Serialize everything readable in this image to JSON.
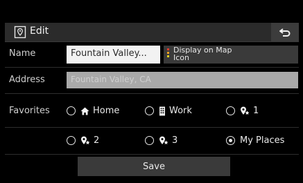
{
  "header": {
    "title": "Edit",
    "back_icon": "back-arrow-icon",
    "title_icon": "edit-location-icon"
  },
  "form": {
    "name": {
      "label": "Name",
      "value": "Fountain Valley..."
    },
    "display_on_map": {
      "line1": "Display on Map",
      "line2": "Icon",
      "swatch_colors": [
        "#e03c2e",
        "#f0a020",
        "#e8d020"
      ]
    },
    "address": {
      "label": "Address",
      "value": "Fountain Valley, CA"
    },
    "favorites": {
      "label": "Favorites",
      "options": [
        {
          "label": "Home",
          "icon": "home-icon",
          "checked": false
        },
        {
          "label": "Work",
          "icon": "work-building-icon",
          "checked": false
        },
        {
          "label": "1",
          "icon": "favorite-pin-icon",
          "checked": false
        },
        {
          "label": "2",
          "icon": "favorite-pin-icon",
          "checked": false
        },
        {
          "label": "3",
          "icon": "favorite-pin-icon",
          "checked": false
        },
        {
          "label": "My Places",
          "icon": "",
          "checked": true
        }
      ]
    }
  },
  "save_label": "Save",
  "colors": {
    "background": "#000000",
    "panel": "#2b2b2b",
    "button": "#3a3a3a",
    "input": "#f2f2f2",
    "address_input": "#a9a9a9"
  }
}
